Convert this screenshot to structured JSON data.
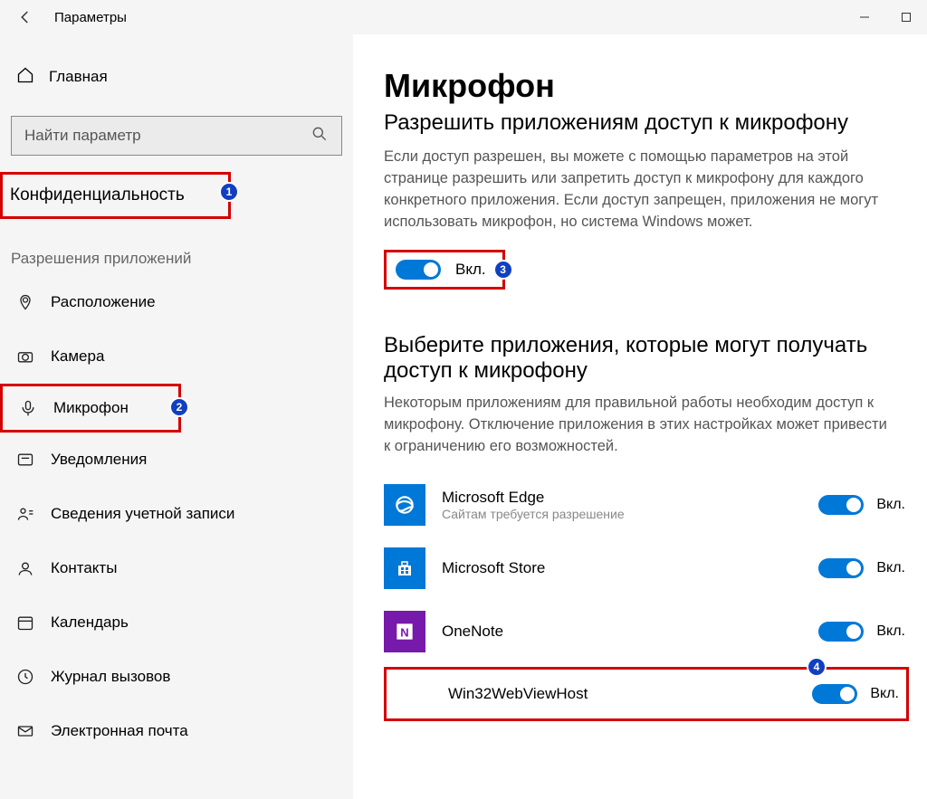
{
  "window": {
    "title": "Параметры"
  },
  "sidebar": {
    "home_label": "Главная",
    "search_placeholder": "Найти параметр",
    "section_link": "Конфиденциальность",
    "group_title": "Разрешения приложений",
    "items": {
      "location": "Расположение",
      "camera": "Камера",
      "microphone": "Микрофон",
      "notifications": "Уведомления",
      "account": "Сведения учетной записи",
      "contacts": "Контакты",
      "calendar": "Календарь",
      "callhistory": "Журнал вызовов",
      "email": "Электронная почта"
    }
  },
  "main": {
    "title": "Микрофон",
    "allow_heading": "Разрешить приложениям доступ к микрофону",
    "allow_body": "Если доступ разрешен, вы можете с помощью параметров на этой странице разрешить или запретить доступ к микрофону для каждого конкретного приложения. Если доступ запрещен, приложения не могут использовать микрофон, но система Windows может.",
    "master_state": "Вкл.",
    "choose_heading": "Выберите приложения, которые могут получать доступ к микрофону",
    "choose_body": "Некоторым приложениям для правильной работы необходим доступ к микрофону. Отключение приложения в этих настройках может привести к ограничению его возможностей.",
    "apps": {
      "edge": {
        "name": "Microsoft Edge",
        "note": "Сайтам требуется разрешение",
        "state": "Вкл."
      },
      "store": {
        "name": "Microsoft Store",
        "state": "Вкл."
      },
      "onenote": {
        "name": "OneNote",
        "state": "Вкл."
      },
      "webview": {
        "name": "Win32WebViewHost",
        "state": "Вкл."
      }
    }
  },
  "annotations": {
    "n1": "1",
    "n2": "2",
    "n3": "3",
    "n4": "4"
  }
}
